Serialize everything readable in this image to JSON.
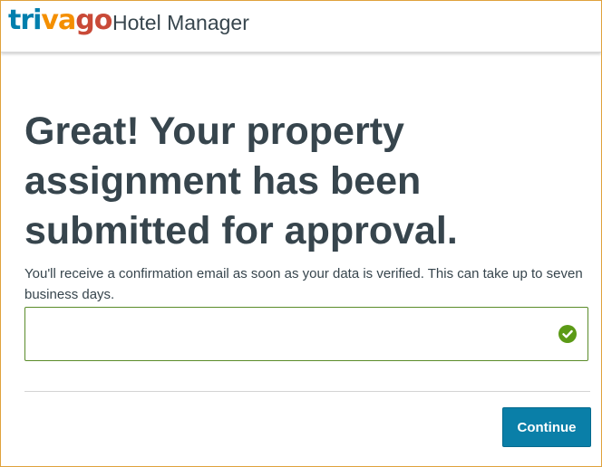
{
  "header": {
    "logo": {
      "part1": "tri",
      "part2": "va",
      "part3": "go"
    },
    "app_name": "Hotel Manager"
  },
  "main": {
    "headline": "Great! Your property assignment has been submitted for approval.",
    "description": "You'll receive a confirmation email as soon as your data is verified. This can take up to seven business days.",
    "field": {
      "value": "",
      "status_icon": "check-circle-icon"
    },
    "continue_label": "Continue"
  },
  "colors": {
    "brand_blue": "#007fad",
    "brand_orange": "#f48f00",
    "brand_red": "#c94a38",
    "text": "#37454d",
    "success_green": "#5b9a16",
    "button": "#0a7fa8",
    "frame_border": "#e0a23c"
  }
}
